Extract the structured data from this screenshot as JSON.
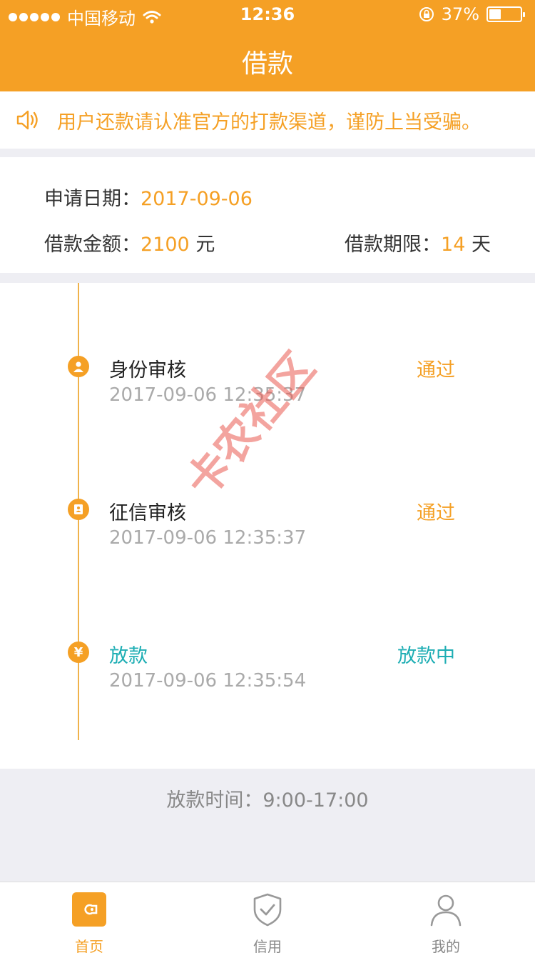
{
  "status_bar": {
    "carrier": "中国移动",
    "time": "12:36",
    "battery": "37%",
    "battery_level": 0.37
  },
  "header": {
    "title": "借款"
  },
  "notice": {
    "text": "用户还款请认准官方的打款渠道，谨防上当受骗。"
  },
  "loan_info": {
    "apply_date_label": "申请日期：",
    "apply_date": "2017-09-06",
    "amount_label": "借款金额：",
    "amount": "2100",
    "amount_unit": "元",
    "term_label": "借款期限：",
    "term": "14",
    "term_unit": "天"
  },
  "timeline": [
    {
      "name": "身份审核",
      "time": "2017-09-06 12:35:37",
      "status": "通过"
    },
    {
      "name": "征信审核",
      "time": "2017-09-06 12:35:37",
      "status": "通过"
    },
    {
      "name": "放款",
      "time": "2017-09-06 12:35:54",
      "status": "放款中",
      "icon_glyph": "¥"
    }
  ],
  "watermark": "卡农社区",
  "loan_hours": "放款时间：9:00-17:00",
  "tabbar": {
    "items": [
      {
        "label": "首页"
      },
      {
        "label": "信用"
      },
      {
        "label": "我的"
      }
    ]
  },
  "colors": {
    "brand": "#f5a025",
    "active": "#1eaeb4",
    "watermark": "#ea5a50"
  }
}
